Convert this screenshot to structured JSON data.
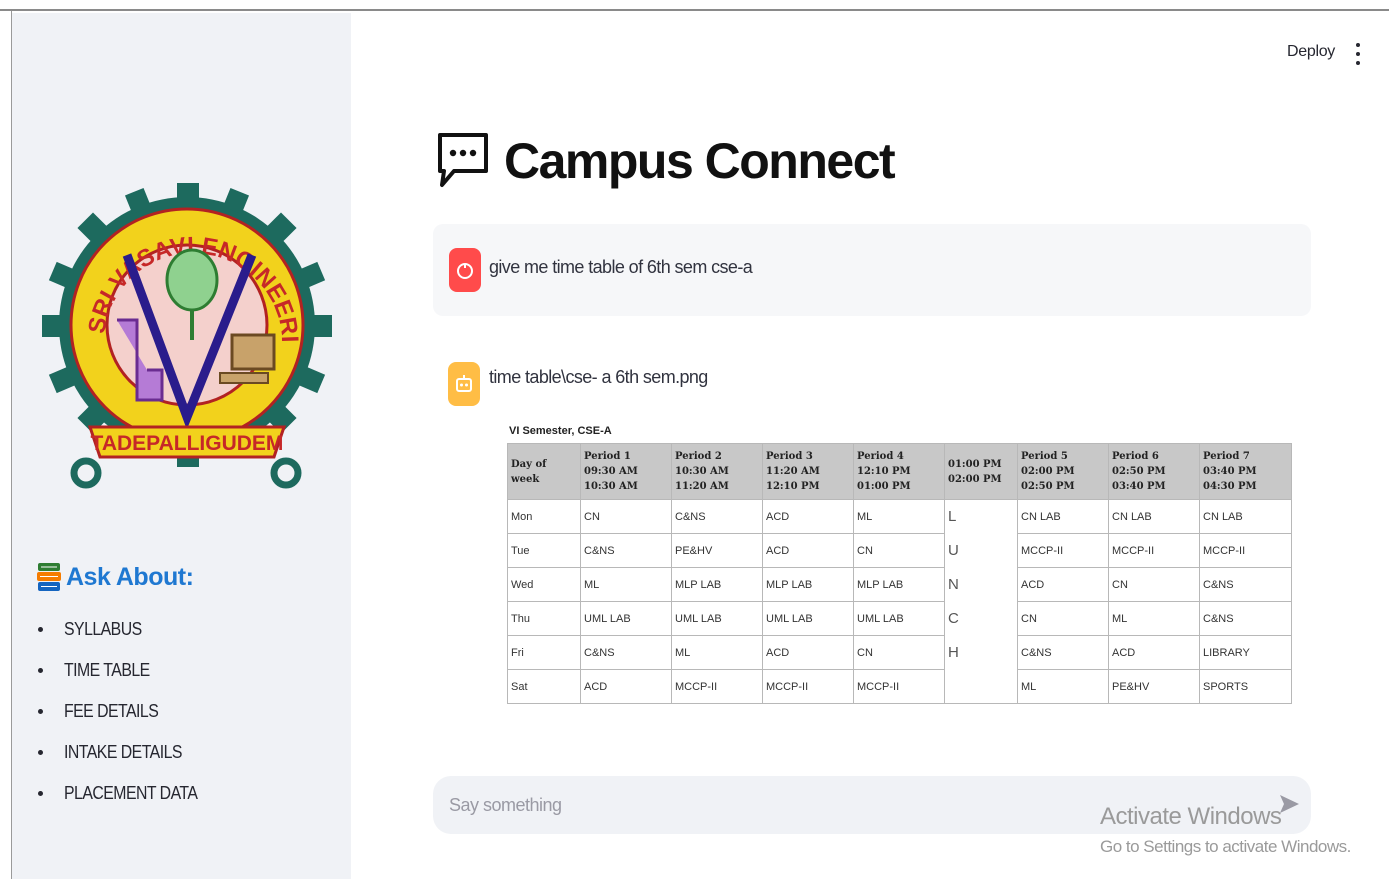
{
  "header": {
    "deploy_label": "Deploy",
    "menu_icon": "kebab-menu-icon"
  },
  "sidebar": {
    "logo": {
      "top_text": "SRI VASAVI ENGINEERING COLLEGE",
      "bottom_text": "TADEPALLIGUDEM"
    },
    "ask_title": "Ask About:",
    "ask_icon": "books-icon",
    "items": [
      {
        "label": "SYLLABUS"
      },
      {
        "label": "TIME TABLE"
      },
      {
        "label": "FEE DETAILS"
      },
      {
        "label": "INTAKE DETAILS"
      },
      {
        "label": "PLACEMENT DATA"
      }
    ]
  },
  "main": {
    "title": "Campus Connect",
    "title_icon": "speech-bubble-icon",
    "messages": [
      {
        "role": "user",
        "text": "give me time table of 6th sem cse-a",
        "avatar_color": "#ff4b4b"
      },
      {
        "role": "assistant",
        "text": "time table\\cse- a 6th sem.png",
        "avatar_color": "#ffbd45"
      }
    ],
    "timetable": {
      "caption": "VI Semester, CSE-A",
      "headers": [
        [
          "Day of week"
        ],
        [
          "Period 1",
          "09:30 AM",
          "10:30 AM"
        ],
        [
          "Period 2",
          "10:30 AM",
          "11:20 AM"
        ],
        [
          "Period 3",
          "11:20 AM",
          "12:10 PM"
        ],
        [
          "Period 4",
          "12:10 PM",
          "01:00 PM"
        ],
        [
          "01:00 PM",
          "02:00 PM"
        ],
        [
          "Period 5",
          "02:00 PM",
          "02:50 PM"
        ],
        [
          "Period 6",
          "02:50 PM",
          "03:40 PM"
        ],
        [
          "Period 7",
          "03:40 PM",
          "04:30 PM"
        ]
      ],
      "rows": [
        [
          "Mon",
          "CN",
          "C&NS",
          "ACD",
          "ML",
          "L",
          "CN LAB",
          "CN LAB",
          "CN LAB"
        ],
        [
          "Tue",
          "C&NS",
          "PE&HV",
          "ACD",
          "CN",
          "U",
          "MCCP-II",
          "MCCP-II",
          "MCCP-II"
        ],
        [
          "Wed",
          "ML",
          "MLP LAB",
          "MLP LAB",
          "MLP LAB",
          "N",
          "ACD",
          "CN",
          "C&NS"
        ],
        [
          "Thu",
          "UML LAB",
          "UML LAB",
          "UML LAB",
          "UML LAB",
          "C",
          "CN",
          "ML",
          "C&NS"
        ],
        [
          "Fri",
          "C&NS",
          "ML",
          "ACD",
          "CN",
          "H",
          "C&NS",
          "ACD",
          "LIBRARY"
        ],
        [
          "Sat",
          "ACD",
          "MCCP-II",
          "MCCP-II",
          "MCCP-II",
          "",
          "ML",
          "PE&HV",
          "SPORTS"
        ]
      ]
    },
    "chat_input": {
      "placeholder": "Say something",
      "send_icon": "send-arrow-icon"
    }
  },
  "watermark": {
    "line1": "Activate Windows",
    "line2": "Go to Settings to activate Windows."
  }
}
